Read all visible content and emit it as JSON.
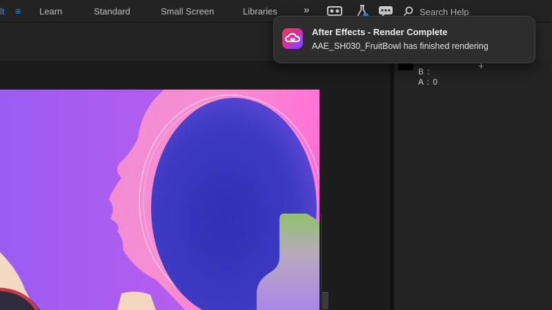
{
  "workspace_bar": {
    "partial_tab": "lt",
    "tabs": [
      "Learn",
      "Standard",
      "Small Screen",
      "Libraries"
    ],
    "overflow_label": "»",
    "search": {
      "placeholder": "Search Help",
      "value": ""
    },
    "accent_color": "#2f8cf6"
  },
  "info_panel": {
    "b_label": "B :",
    "a_label": "A : 0",
    "crosshair_glyph": "+"
  },
  "notification": {
    "app_icon": "creative-cloud-icon",
    "title": "After Effects - Render Complete",
    "message": "AAE_SH030_FruitBowl has finished rendering"
  },
  "composition": {
    "colors": {
      "background": "#a15cf1",
      "mirror": "#3a3bb8",
      "mirror_glow": "#f56bd8"
    }
  }
}
